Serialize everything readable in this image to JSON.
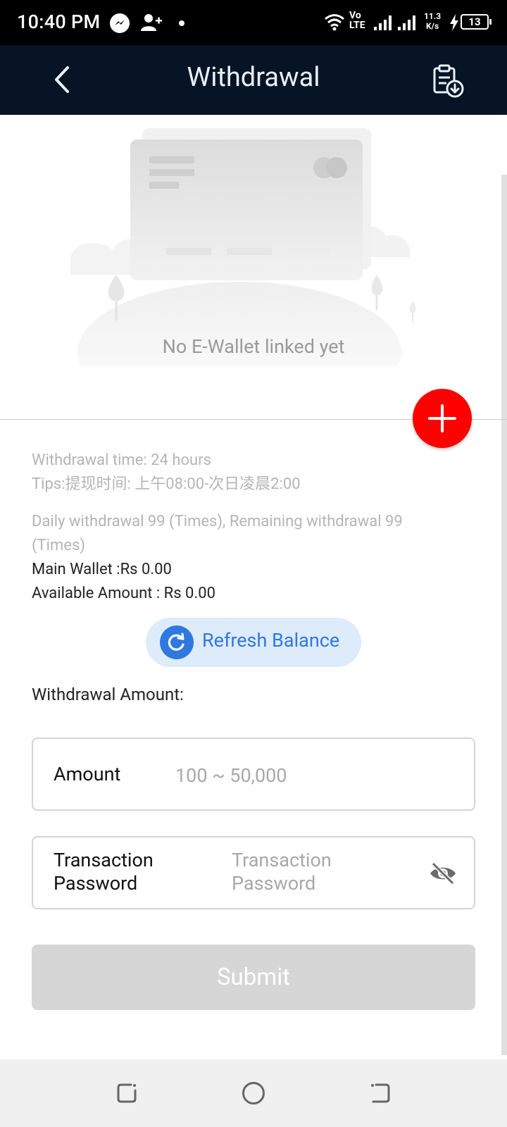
{
  "status_bar": {
    "time": "10:40 PM",
    "network_top": "Vo",
    "network_bottom": "LTE",
    "speed_value": "11.3",
    "speed_unit": "K/s",
    "battery": "13"
  },
  "header": {
    "title": "Withdrawal"
  },
  "empty_state": {
    "message": "No E-Wallet linked yet"
  },
  "info": {
    "withdrawal_time": "Withdrawal time:   24 hours",
    "tips": "Tips:提现时间: 上午08:00-次日凌晨2:00",
    "daily_limit_line1": "Daily withdrawal 99 (Times), Remaining withdrawal 99",
    "daily_limit_line2": "(Times)",
    "main_wallet": "Main Wallet :Rs 0.00",
    "available_amount": "Available Amount : Rs 0.00"
  },
  "refresh": {
    "label": "Refresh Balance"
  },
  "form": {
    "section_label": "Withdrawal Amount:",
    "amount_label": "Amount",
    "amount_placeholder": "100 ~ 50,000",
    "password_label_line1": "Transaction",
    "password_label_line2": "Password",
    "password_placeholder_line1": "Transaction",
    "password_placeholder_line2": "Password",
    "submit_label": "Submit"
  },
  "colors": {
    "header_bg": "#061425",
    "add_button": "#ff0000",
    "accent_blue": "#2f78e0",
    "refresh_bg": "#ddebfb",
    "submit_disabled": "#d6d6d6"
  },
  "icons": {
    "status": [
      "messenger-icon",
      "person-add-icon",
      "wifi-icon",
      "signal-icon",
      "battery-icon"
    ],
    "header": [
      "back-arrow-icon",
      "clipboard-download-icon"
    ],
    "actions": [
      "plus-icon",
      "refresh-icon",
      "eye-off-icon"
    ],
    "navigation": [
      "recents-icon",
      "home-icon",
      "back-icon"
    ]
  }
}
